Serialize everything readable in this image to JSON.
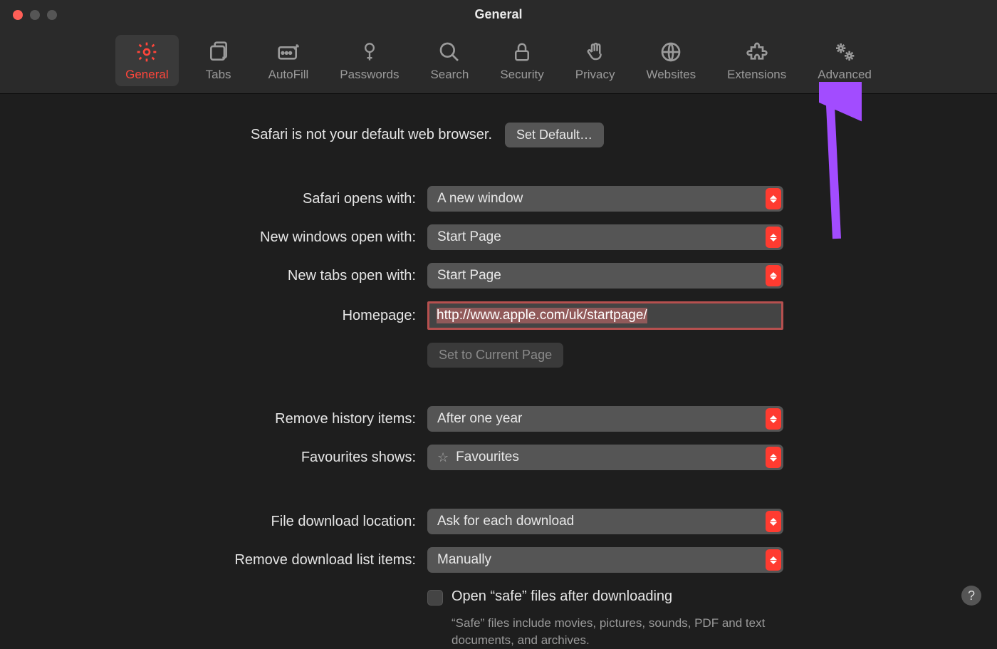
{
  "window": {
    "title": "General"
  },
  "toolbar": {
    "items": [
      {
        "id": "general",
        "label": "General",
        "active": true
      },
      {
        "id": "tabs",
        "label": "Tabs",
        "active": false
      },
      {
        "id": "autofill",
        "label": "AutoFill",
        "active": false
      },
      {
        "id": "passwords",
        "label": "Passwords",
        "active": false
      },
      {
        "id": "search",
        "label": "Search",
        "active": false
      },
      {
        "id": "security",
        "label": "Security",
        "active": false
      },
      {
        "id": "privacy",
        "label": "Privacy",
        "active": false
      },
      {
        "id": "websites",
        "label": "Websites",
        "active": false
      },
      {
        "id": "extensions",
        "label": "Extensions",
        "active": false
      },
      {
        "id": "advanced",
        "label": "Advanced",
        "active": false
      }
    ]
  },
  "default_browser": {
    "message": "Safari is not your default web browser.",
    "button": "Set Default…"
  },
  "opens_with": {
    "label": "Safari opens with:",
    "value": "A new window"
  },
  "new_windows": {
    "label": "New windows open with:",
    "value": "Start Page"
  },
  "new_tabs": {
    "label": "New tabs open with:",
    "value": "Start Page"
  },
  "homepage": {
    "label": "Homepage:",
    "value": "http://www.apple.com/uk/startpage/",
    "set_current": "Set to Current Page"
  },
  "remove_history": {
    "label": "Remove history items:",
    "value": "After one year"
  },
  "favourites": {
    "label": "Favourites shows:",
    "value": "Favourites"
  },
  "download_location": {
    "label": "File download location:",
    "value": "Ask for each download"
  },
  "remove_downloads": {
    "label": "Remove download list items:",
    "value": "Manually"
  },
  "safe_files": {
    "label": "Open “safe” files after downloading",
    "hint": "“Safe” files include movies, pictures, sounds, PDF and text documents, and archives.",
    "checked": false
  },
  "help": "?",
  "colors": {
    "accent": "#ff453a",
    "selection": "#b6504f",
    "arrow": "#a24cff"
  }
}
